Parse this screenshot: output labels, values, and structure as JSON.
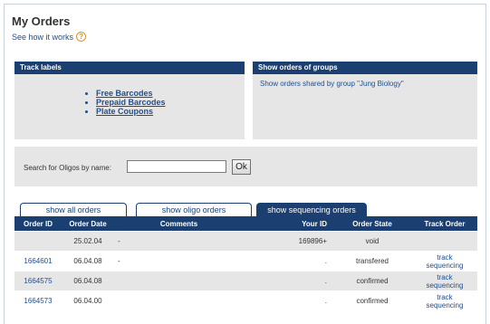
{
  "header": {
    "title": "My Orders",
    "how_link": "See how it works",
    "help_glyph": "?"
  },
  "panels": {
    "track": {
      "title": "Track labels",
      "links": [
        "Free Barcodes",
        "Prepaid Barcodes",
        "Plate Coupons"
      ]
    },
    "groups": {
      "title": "Show orders of groups",
      "text": "Show orders shared by group \"Jung Biology\""
    }
  },
  "search": {
    "label": "Search for Oligos by name:",
    "value": "",
    "button": "Ok"
  },
  "tabs": [
    {
      "label": "show all orders",
      "active": false
    },
    {
      "label": "show oligo orders",
      "active": false
    },
    {
      "label": "show sequencing orders",
      "active": true
    }
  ],
  "table": {
    "headers": [
      "Order ID",
      "Order Date",
      "Comments",
      "Your ID",
      "Order State",
      "Track Order"
    ],
    "rows": [
      {
        "id": "",
        "date": "25.02.04",
        "comments": "-",
        "your_id": "169896+",
        "state": "void",
        "track1": "",
        "track2": ""
      },
      {
        "id": "1664601",
        "date": "06.04.08",
        "comments": "-",
        "your_id": ".",
        "state": "transfered",
        "track1": "track",
        "track2": "sequencing"
      },
      {
        "id": "1664575",
        "date": "06.04.08",
        "comments": "",
        "your_id": ".",
        "state": "confirmed",
        "track1": "track",
        "track2": "sequencing"
      },
      {
        "id": "1664573",
        "date": "06.04.00",
        "comments": "",
        "your_id": ".",
        "state": "confirmed",
        "track1": "track",
        "track2": "sequencing"
      }
    ]
  },
  "colors": {
    "header_bg": "#1b3f71",
    "panel_bg": "#e6e6e6",
    "link": "#1f4f8f",
    "help": "#e0922b"
  }
}
